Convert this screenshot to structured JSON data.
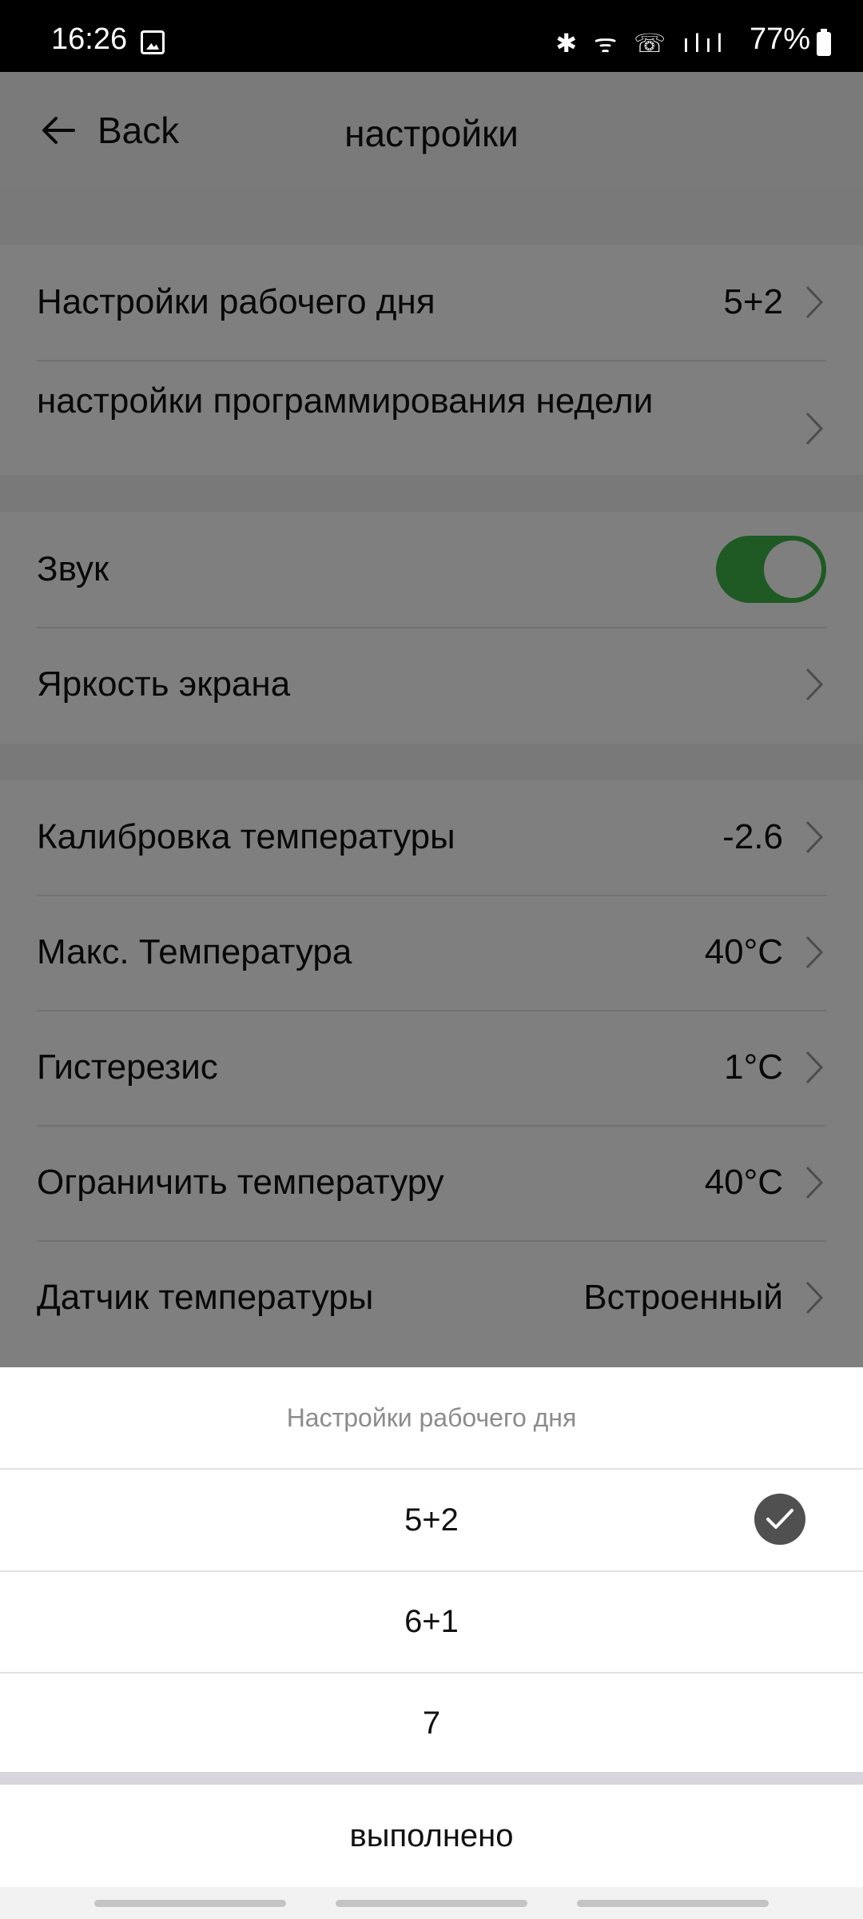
{
  "status_bar": {
    "time": "16:26",
    "icons": "✱ ᯤ ☏ ılıl",
    "battery_percent": "77%"
  },
  "header": {
    "back_label": "Back",
    "title": "настройки"
  },
  "groups": [
    {
      "rows": [
        {
          "label": "Настройки рабочего дня",
          "value": "5+2"
        },
        {
          "label": "настройки программирования недели",
          "value": ""
        }
      ]
    },
    {
      "rows": [
        {
          "label": "Звук",
          "toggle_on": true
        },
        {
          "label": "Яркость экрана",
          "value": ""
        }
      ]
    },
    {
      "rows": [
        {
          "label": "Калибровка температуры",
          "value": "-2.6"
        },
        {
          "label": "Макс. Температура",
          "value": "40°C"
        },
        {
          "label": "Гистерезис",
          "value": "1°C"
        },
        {
          "label": "Ограничить температуру",
          "value": "40°C"
        },
        {
          "label": "Датчик температуры",
          "value": "Встроенный"
        }
      ]
    }
  ],
  "sheet": {
    "title": "Настройки рабочего дня",
    "options": [
      "5+2",
      "6+1",
      "7"
    ],
    "selected": "5+2",
    "done_label": "выполнено"
  },
  "colors": {
    "toggle_on": "#3fb54a",
    "check_bg": "#505050",
    "overlay": "rgba(0,0,0,0.5)"
  }
}
